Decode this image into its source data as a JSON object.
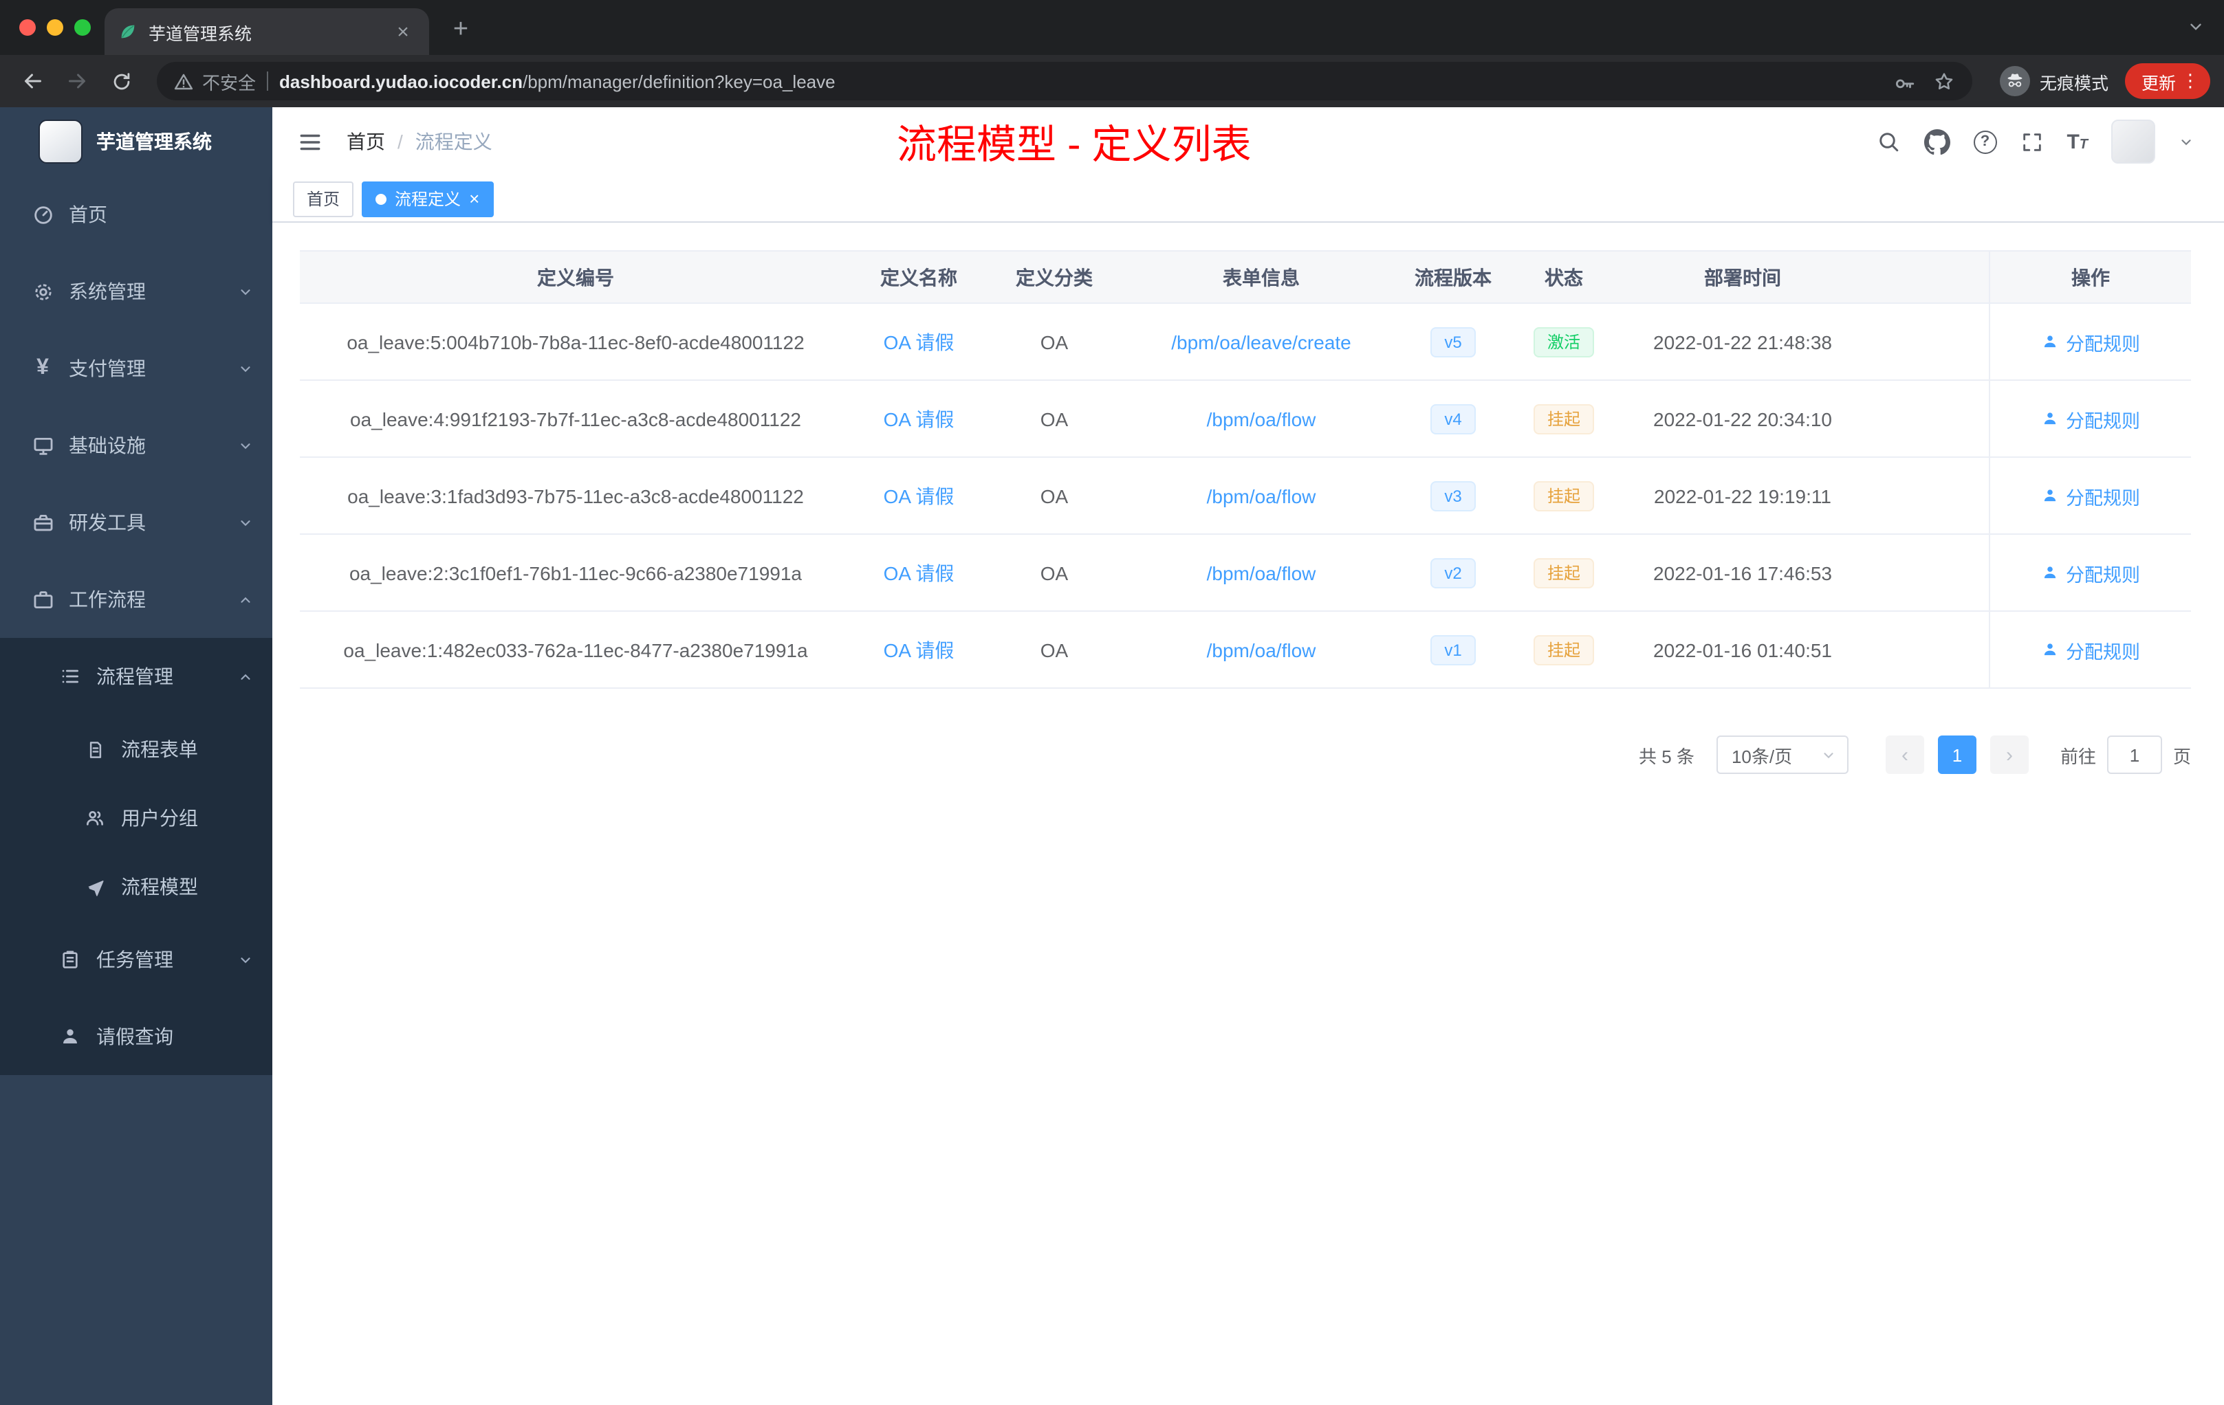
{
  "colors": {
    "accent": "#409eff",
    "success": "#13ce66",
    "warning": "#e6a23c",
    "annotation_red": "#ff0000",
    "sidebar_bg": "#304156",
    "submenu_bg": "#1f2d3d"
  },
  "icons": {
    "close": "×",
    "new_tab": "+",
    "more_dots": "⋮",
    "prev": "‹",
    "next": "›",
    "question": "?",
    "yen": "¥",
    "font_big": "T",
    "font_small": "T"
  },
  "browser": {
    "tab_title": "芋道管理系统",
    "security_label": "不安全",
    "url_domain": "dashboard.yudao.iocoder.cn",
    "url_path": "/bpm/manager/definition?key=oa_leave",
    "incognito_label": "无痕模式",
    "update_label": "更新"
  },
  "sidebar": {
    "logo_title": "芋道管理系统",
    "items": [
      {
        "label": "首页"
      },
      {
        "label": "系统管理"
      },
      {
        "label": "支付管理"
      },
      {
        "label": "基础设施"
      },
      {
        "label": "研发工具"
      },
      {
        "label": "工作流程"
      },
      {
        "label": "流程管理"
      },
      {
        "label": "流程表单"
      },
      {
        "label": "用户分组"
      },
      {
        "label": "流程模型"
      },
      {
        "label": "任务管理"
      },
      {
        "label": "请假查询"
      }
    ]
  },
  "navbar": {
    "breadcrumb_home": "首页",
    "breadcrumb_sep": "/",
    "breadcrumb_current": "流程定义",
    "annotation": "流程模型 - 定义列表"
  },
  "tags": {
    "home": "首页",
    "current": "流程定义"
  },
  "table": {
    "columns": [
      "定义编号",
      "定义名称",
      "定义分类",
      "表单信息",
      "流程版本",
      "状态",
      "部署时间",
      "操作"
    ],
    "rows": [
      {
        "id": "oa_leave:5:004b710b-7b8a-11ec-8ef0-acde48001122",
        "name": "OA 请假",
        "category": "OA",
        "form": "/bpm/oa/leave/create",
        "version": "v5",
        "status": "激活",
        "status_type": "success",
        "time": "2022-01-22 21:48:38",
        "action": "分配规则"
      },
      {
        "id": "oa_leave:4:991f2193-7b7f-11ec-a3c8-acde48001122",
        "name": "OA 请假",
        "category": "OA",
        "form": "/bpm/oa/flow",
        "version": "v4",
        "status": "挂起",
        "status_type": "warning",
        "time": "2022-01-22 20:34:10",
        "action": "分配规则"
      },
      {
        "id": "oa_leave:3:1fad3d93-7b75-11ec-a3c8-acde48001122",
        "name": "OA 请假",
        "category": "OA",
        "form": "/bpm/oa/flow",
        "version": "v3",
        "status": "挂起",
        "status_type": "warning",
        "time": "2022-01-22 19:19:11",
        "action": "分配规则"
      },
      {
        "id": "oa_leave:2:3c1f0ef1-76b1-11ec-9c66-a2380e71991a",
        "name": "OA 请假",
        "category": "OA",
        "form": "/bpm/oa/flow",
        "version": "v2",
        "status": "挂起",
        "status_type": "warning",
        "time": "2022-01-16 17:46:53",
        "action": "分配规则"
      },
      {
        "id": "oa_leave:1:482ec033-762a-11ec-8477-a2380e71991a",
        "name": "OA 请假",
        "category": "OA",
        "form": "/bpm/oa/flow",
        "version": "v1",
        "status": "挂起",
        "status_type": "warning",
        "time": "2022-01-16 01:40:51",
        "action": "分配规则"
      }
    ]
  },
  "pagination": {
    "total": "共 5 条",
    "page_size": "10条/页",
    "current_page": "1",
    "goto_prefix": "前往",
    "goto_value": "1",
    "goto_suffix": "页"
  }
}
